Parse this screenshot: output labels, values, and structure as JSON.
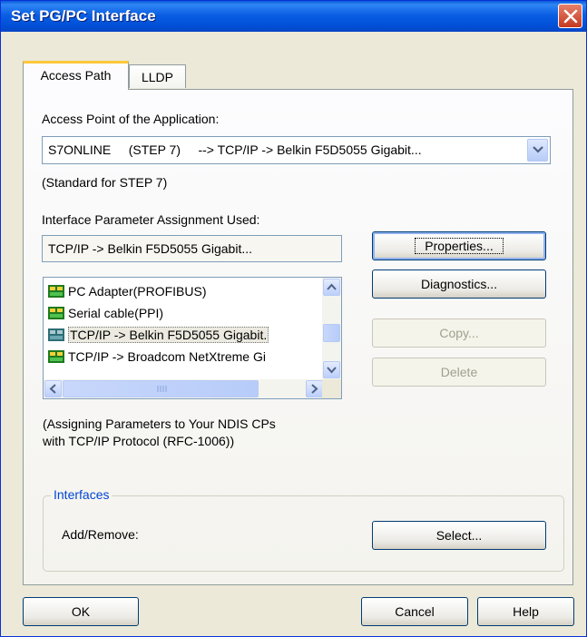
{
  "window": {
    "title": "Set PG/PC Interface"
  },
  "tabs": [
    {
      "label": "Access Path"
    },
    {
      "label": "LLDP"
    }
  ],
  "access_point": {
    "label": "Access Point of the Application:",
    "value": "S7ONLINE     (STEP 7)     --> TCP/IP -> Belkin F5D5055 Gigabit...",
    "note": "(Standard for STEP 7)"
  },
  "interface_param": {
    "label": "Interface Parameter Assignment Used:",
    "value": "TCP/IP -> Belkin F5D5055 Gigabit..."
  },
  "list": {
    "items": [
      {
        "label": "PC Adapter(PROFIBUS)",
        "icon": "pc-adapter-icon"
      },
      {
        "label": "Serial cable(PPI)",
        "icon": "serial-cable-icon"
      },
      {
        "label": "TCP/IP -> Belkin F5D5055 Gigabit.",
        "icon": "network-card-icon",
        "selected": true
      },
      {
        "label": "TCP/IP -> Broadcom NetXtreme Gi",
        "icon": "network-card-icon"
      }
    ]
  },
  "buttons": {
    "properties": "Properties...",
    "diagnostics": "Diagnostics...",
    "copy": "Copy...",
    "delete": "Delete",
    "select": "Select...",
    "ok": "OK",
    "cancel": "Cancel",
    "help": "Help"
  },
  "description": {
    "line1": "(Assigning Parameters to Your NDIS CPs",
    "line2": "with TCP/IP Protocol (RFC-1006))"
  },
  "interfaces": {
    "title": "Interfaces",
    "add_remove_label": "Add/Remove:"
  },
  "colors": {
    "titlebar": "#0054e3",
    "dialog_bg": "#ece9d8",
    "selection": "#eceae0",
    "group_title": "#0046d5"
  }
}
